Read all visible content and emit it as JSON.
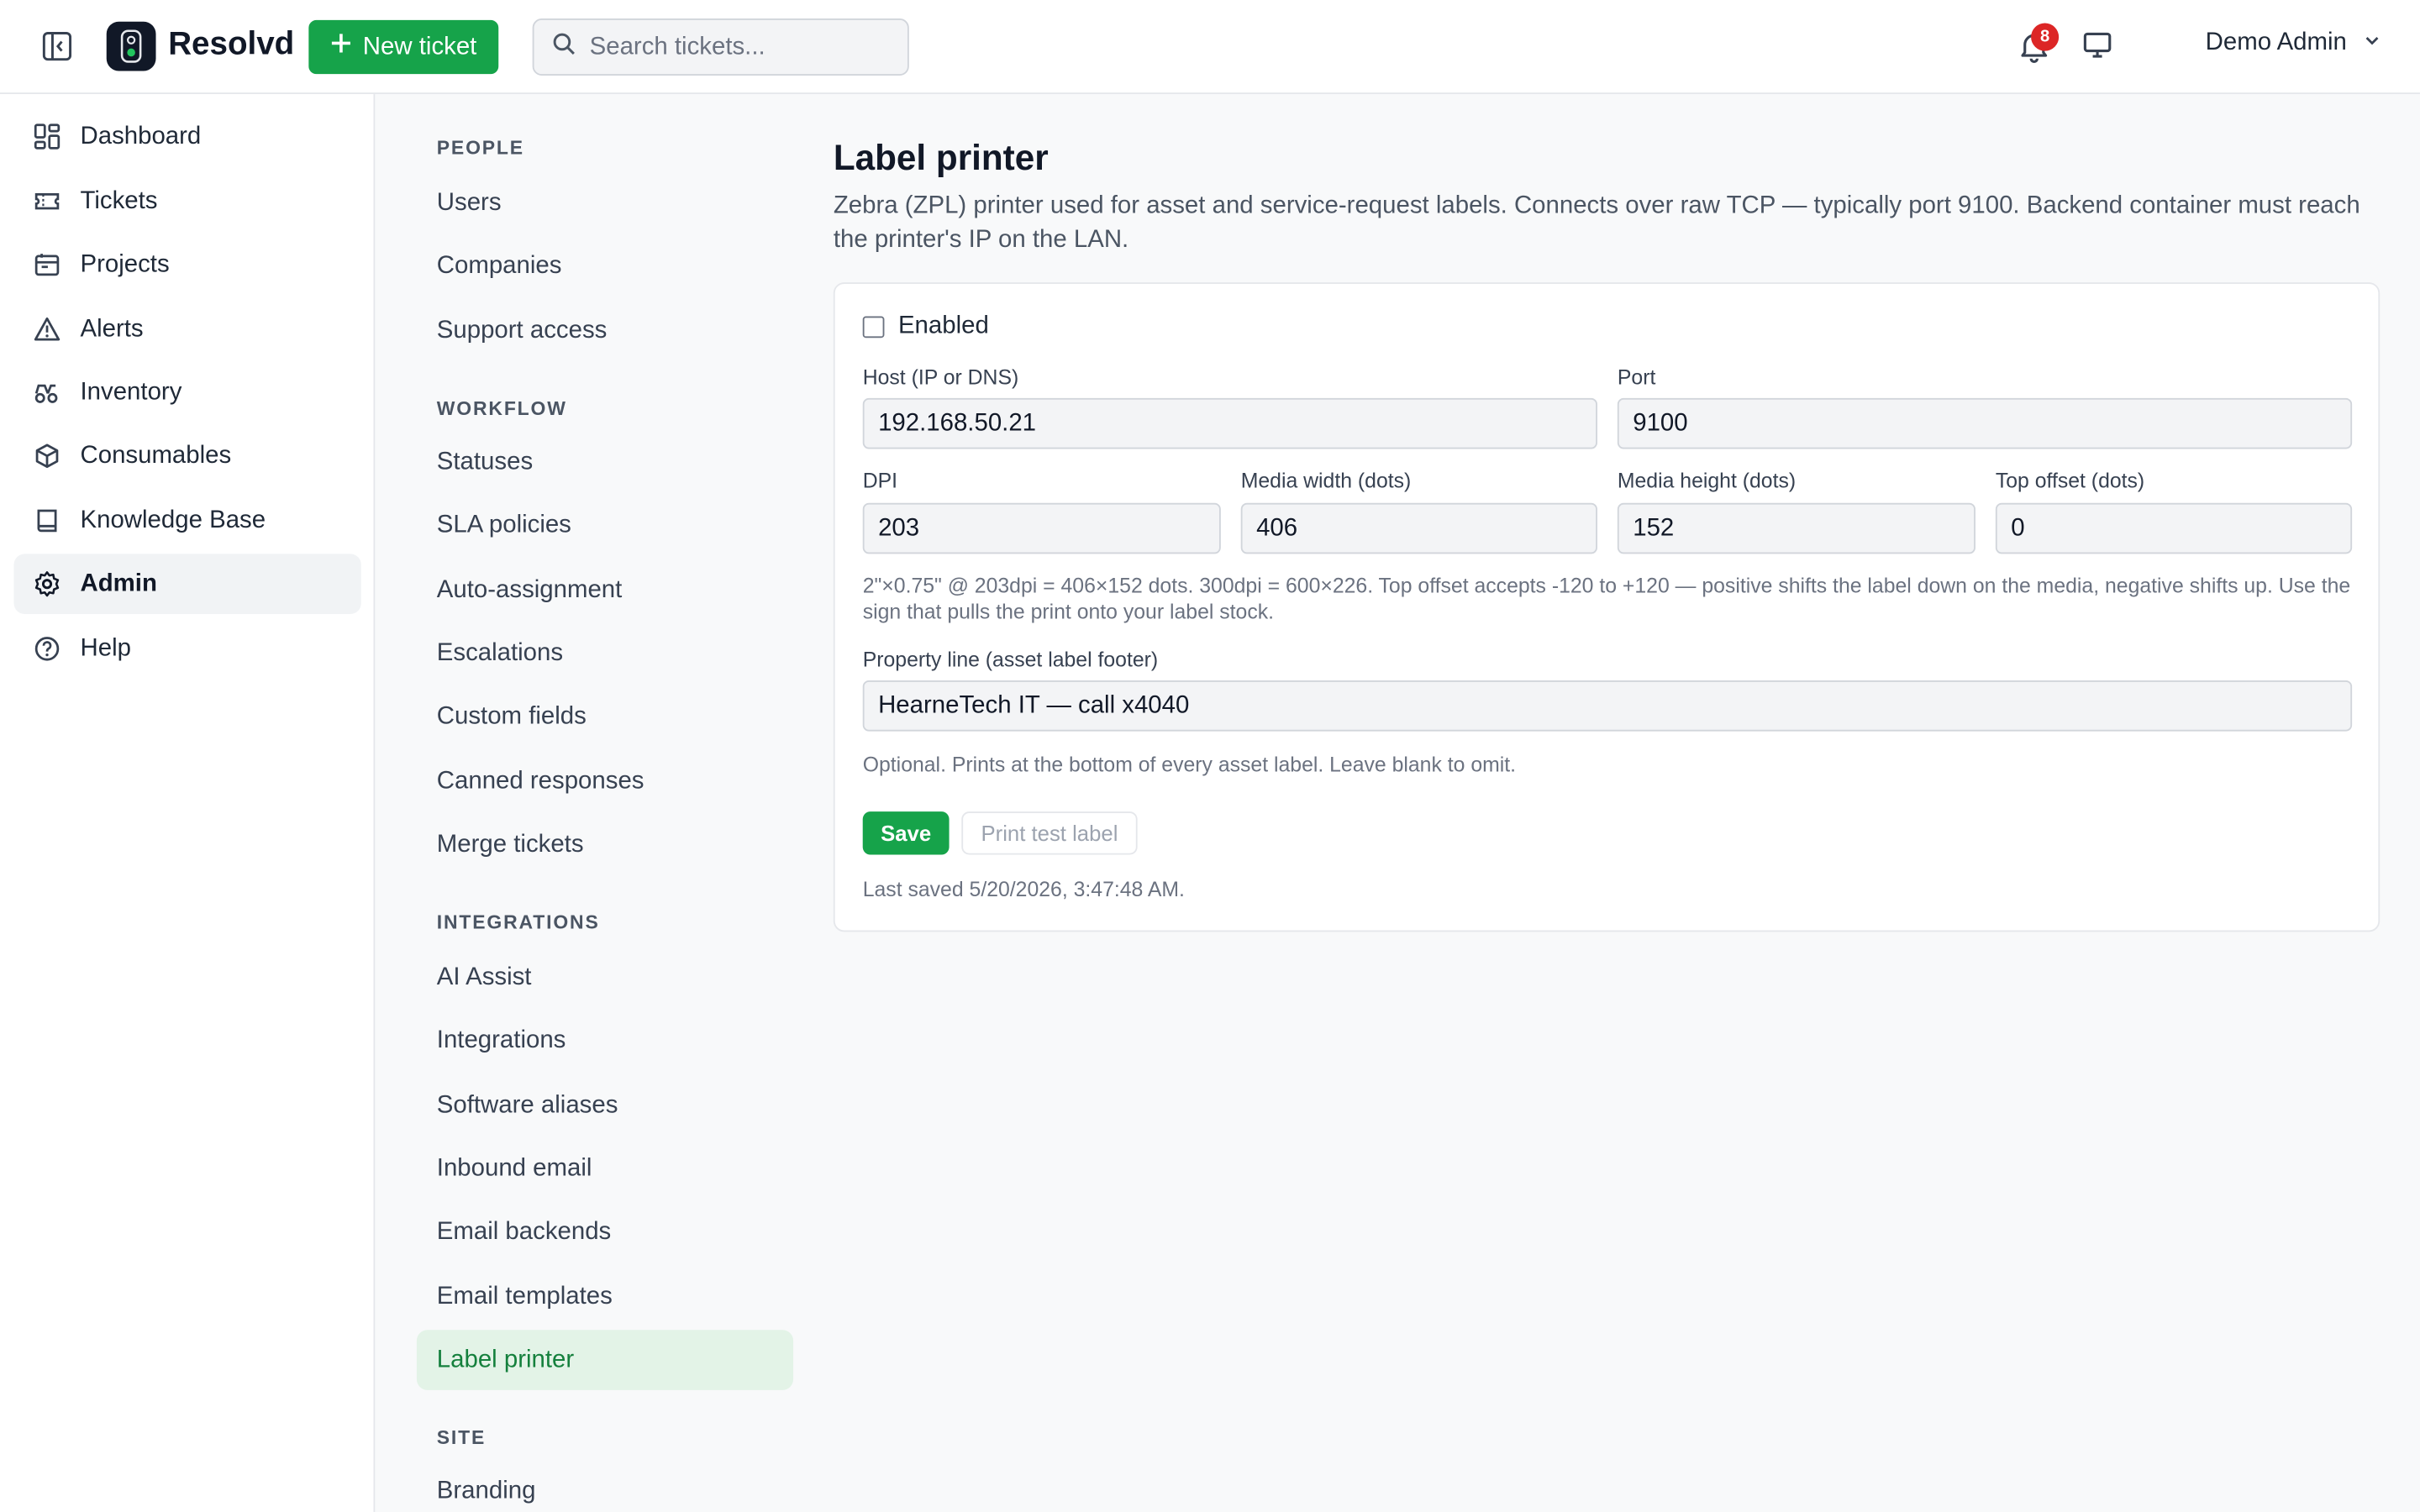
{
  "header": {
    "brand": "Resolvd",
    "new_ticket_label": "New ticket",
    "search_placeholder": "Search tickets...",
    "notification_count": "8",
    "user_name": "Demo Admin"
  },
  "nav": {
    "items": [
      {
        "label": "Dashboard",
        "icon": "dashboard-icon"
      },
      {
        "label": "Tickets",
        "icon": "ticket-icon"
      },
      {
        "label": "Projects",
        "icon": "projects-icon"
      },
      {
        "label": "Alerts",
        "icon": "alert-icon"
      },
      {
        "label": "Inventory",
        "icon": "inventory-icon"
      },
      {
        "label": "Consumables",
        "icon": "box-icon"
      },
      {
        "label": "Knowledge Base",
        "icon": "book-icon"
      },
      {
        "label": "Admin",
        "icon": "gear-icon",
        "active": true
      },
      {
        "label": "Help",
        "icon": "help-icon"
      }
    ]
  },
  "admin_nav": {
    "sections": [
      {
        "title": "PEOPLE",
        "items": [
          "Users",
          "Companies",
          "Support access"
        ]
      },
      {
        "title": "WORKFLOW",
        "items": [
          "Statuses",
          "SLA policies",
          "Auto-assignment",
          "Escalations",
          "Custom fields",
          "Canned responses",
          "Merge tickets"
        ]
      },
      {
        "title": "INTEGRATIONS",
        "items": [
          "AI Assist",
          "Integrations",
          "Software aliases",
          "Inbound email",
          "Email backends",
          "Email templates",
          "Label printer"
        ]
      },
      {
        "title": "SITE",
        "items": [
          "Branding"
        ]
      }
    ],
    "active_item": "Label printer"
  },
  "page": {
    "title": "Label printer",
    "description": "Zebra (ZPL) printer used for asset and service-request labels. Connects over raw TCP — typically port 9100. Backend container must reach the printer's IP on the LAN.",
    "enabled_label": "Enabled",
    "enabled": false,
    "host_label": "Host (IP or DNS)",
    "host_value": "192.168.50.21",
    "port_label": "Port",
    "port_value": "9100",
    "dpi_label": "DPI",
    "dpi_value": "203",
    "media_width_label": "Media width (dots)",
    "media_width_value": "406",
    "media_height_label": "Media height (dots)",
    "media_height_value": "152",
    "top_offset_label": "Top offset (dots)",
    "top_offset_value": "0",
    "dims_help": "2\"×0.75\" @ 203dpi = 406×152 dots. 300dpi = 600×226. Top offset accepts -120 to +120 — positive shifts the label down on the media, negative shifts up. Use the sign that pulls the print onto your label stock.",
    "property_label": "Property line (asset label footer)",
    "property_value": "HearneTech IT — call x4040",
    "property_help": "Optional. Prints at the bottom of every asset label. Leave blank to omit.",
    "save_label": "Save",
    "test_label": "Print test label",
    "last_saved": "Last saved 5/20/2026, 3:47:48 AM."
  },
  "colors": {
    "accent": "#16a34a",
    "badge": "#dc2626",
    "active_sub_bg": "#e3f3e7"
  }
}
